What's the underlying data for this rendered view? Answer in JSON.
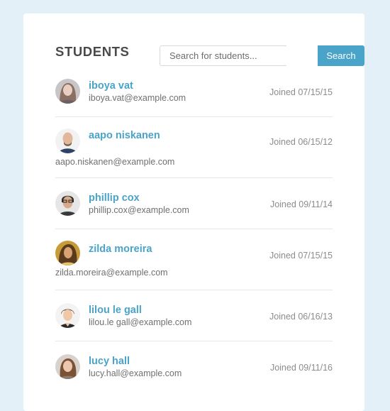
{
  "header": {
    "title": "STUDENTS",
    "search_placeholder": "Search for students...",
    "search_button_label": "Search"
  },
  "students": [
    {
      "name": "iboya vat",
      "email": "iboya.vat@example.com",
      "joined": "Joined 07/15/15",
      "avatar_icon": "woman-portrait-icon"
    },
    {
      "name": "aapo niskanen",
      "email": "aapo.niskanen@example.com",
      "joined": "Joined 06/15/12",
      "avatar_icon": "man-portrait-icon"
    },
    {
      "name": "phillip cox",
      "email": "phillip.cox@example.com",
      "joined": "Joined 09/11/14",
      "avatar_icon": "man-portrait-icon"
    },
    {
      "name": "zilda moreira",
      "email": "zilda.moreira@example.com",
      "joined": "Joined 07/15/15",
      "avatar_icon": "woman-portrait-icon"
    },
    {
      "name": "lilou le gall",
      "email": "lilou.le gall@example.com",
      "joined": "Joined 06/16/13",
      "avatar_icon": "woman-portrait-icon"
    },
    {
      "name": "lucy hall",
      "email": "lucy.hall@example.com",
      "joined": "Joined 09/11/16",
      "avatar_icon": "woman-portrait-icon"
    }
  ],
  "colors": {
    "page_background": "#e3f0f7",
    "card_background": "#ffffff",
    "accent": "#4aa3c8",
    "title_text": "#4a4a4a",
    "muted_text": "#8c8c8c"
  }
}
